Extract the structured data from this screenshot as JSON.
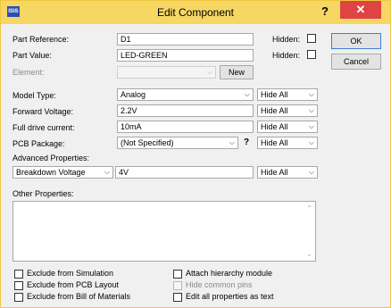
{
  "window": {
    "title": "Edit Component",
    "app_icon": "ISIS",
    "help_glyph": "?",
    "close_glyph": "✕"
  },
  "part_reference": {
    "label": "Part Reference:",
    "value": "D1",
    "hidden_label": "Hidden:",
    "hidden_checked": false
  },
  "part_value": {
    "label": "Part Value:",
    "value": "LED-GREEN",
    "hidden_label": "Hidden:",
    "hidden_checked": false
  },
  "element": {
    "label": "Element:",
    "value": "",
    "new_button": "New"
  },
  "model_type": {
    "label": "Model Type:",
    "value": "Analog",
    "visibility": "Hide All"
  },
  "forward_voltage": {
    "label": "Forward Voltage:",
    "value": "2.2V",
    "visibility": "Hide All"
  },
  "full_drive_current": {
    "label": "Full drive current:",
    "value": "10mA",
    "visibility": "Hide All"
  },
  "pcb_package": {
    "label": "PCB Package:",
    "value": "(Not Specified)",
    "help": "?",
    "visibility": "Hide All"
  },
  "advanced": {
    "label": "Advanced Properties:",
    "property": "Breakdown Voltage",
    "value": "4V",
    "visibility": "Hide All"
  },
  "other_properties": {
    "label": "Other Properties:",
    "value": ""
  },
  "buttons": {
    "ok": "OK",
    "cancel": "Cancel"
  },
  "dropdown_arrow": "⌵",
  "scroll_up": "⌃",
  "scroll_down": "⌄",
  "options_left": [
    {
      "label": "Exclude from Simulation",
      "checked": false
    },
    {
      "label": "Exclude from PCB Layout",
      "checked": false
    },
    {
      "label": "Exclude from Bill of Materials",
      "checked": false
    }
  ],
  "options_right": [
    {
      "label": "Attach hierarchy module",
      "checked": false,
      "disabled": false
    },
    {
      "label": "Hide common pins",
      "checked": false,
      "disabled": true
    },
    {
      "label": "Edit all properties as text",
      "checked": false,
      "disabled": false
    }
  ],
  "colors": {
    "titlebar": "#f6d763",
    "close": "#e04343",
    "ok_border": "#3c7fd6"
  }
}
